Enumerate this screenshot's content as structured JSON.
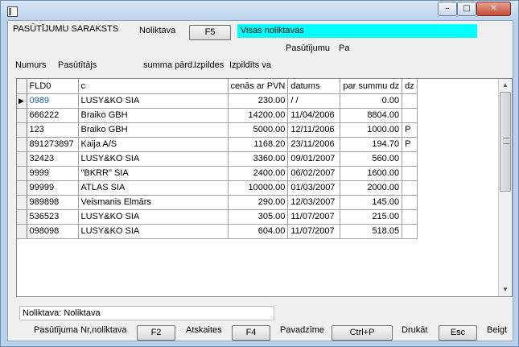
{
  "window": {
    "min_glyph": "–",
    "max_glyph": "□",
    "close_glyph": "✕"
  },
  "header": {
    "title": "PASŪTĪJUMU SARAKSTS",
    "noliktava_label": "Noliktava",
    "f5_button": "F5",
    "warehouse_value": "Visas noliktavas",
    "pasutijumu_label": "Pasūtījumu",
    "pa_label": "Pa"
  },
  "columns_row": {
    "numurs": "Numurs",
    "pasutitajs": "Pasūtītājs",
    "summa": "summa pārd.",
    "izpildes": "Izpildes",
    "izpildits": "Izpildīts va"
  },
  "table": {
    "headers": [
      "FLD0",
      "c",
      "cenās ar PVN",
      "datums",
      "par summu dz",
      "dz"
    ],
    "rows": [
      {
        "fld0": "0989",
        "c": "LUSY&KO SIA",
        "cena": "230.00",
        "datums": " /  /",
        "summa": "0.00",
        "dz": ""
      },
      {
        "fld0": "666222",
        "c": "Braiko GBH",
        "cena": "14200.00",
        "datums": "11/04/2006",
        "summa": "8804.00",
        "dz": ""
      },
      {
        "fld0": "123",
        "c": "Braiko GBH",
        "cena": "5000.00",
        "datums": "12/11/2006",
        "summa": "1000.00",
        "dz": "P"
      },
      {
        "fld0": "891273897",
        "c": "Kaija A/S",
        "cena": "1168.20",
        "datums": "23/11/2006",
        "summa": "194.70",
        "dz": "P"
      },
      {
        "fld0": "32423",
        "c": "LUSY&KO SIA",
        "cena": "3360.00",
        "datums": "09/01/2007",
        "summa": "560.00",
        "dz": ""
      },
      {
        "fld0": "9999",
        "c": "\"BKRR\" SIA",
        "cena": "2400.00",
        "datums": "06/02/2007",
        "summa": "1600.00",
        "dz": ""
      },
      {
        "fld0": "99999",
        "c": "ATLAS SIA",
        "cena": "10000.00",
        "datums": "01/03/2007",
        "summa": "2000.00",
        "dz": ""
      },
      {
        "fld0": "989898",
        "c": "Veismanis Elmārs",
        "cena": "290.00",
        "datums": "12/03/2007",
        "summa": "145.00",
        "dz": ""
      },
      {
        "fld0": "536523",
        "c": "LUSY&KO SIA",
        "cena": "305.00",
        "datums": "11/07/2007",
        "summa": "215.00",
        "dz": ""
      },
      {
        "fld0": "098098",
        "c": "LUSY&KO SIA",
        "cena": "604.00",
        "datums": "11/07/2007",
        "summa": "518.05",
        "dz": ""
      }
    ]
  },
  "status": {
    "text": "Noliktava: Noliktava"
  },
  "footer": {
    "pasutijuma_label": "Pasūtījuma Nr,noliktava",
    "f2_button": "F2",
    "atskaites_label": "Atskaites",
    "f4_button": "F4",
    "pavadzime_label": "Pavadzīme",
    "ctrlp_button": "Ctrl+P",
    "druk_label": "Drukāt",
    "esc_button": "Esc",
    "beigt_label": "Beigt"
  }
}
